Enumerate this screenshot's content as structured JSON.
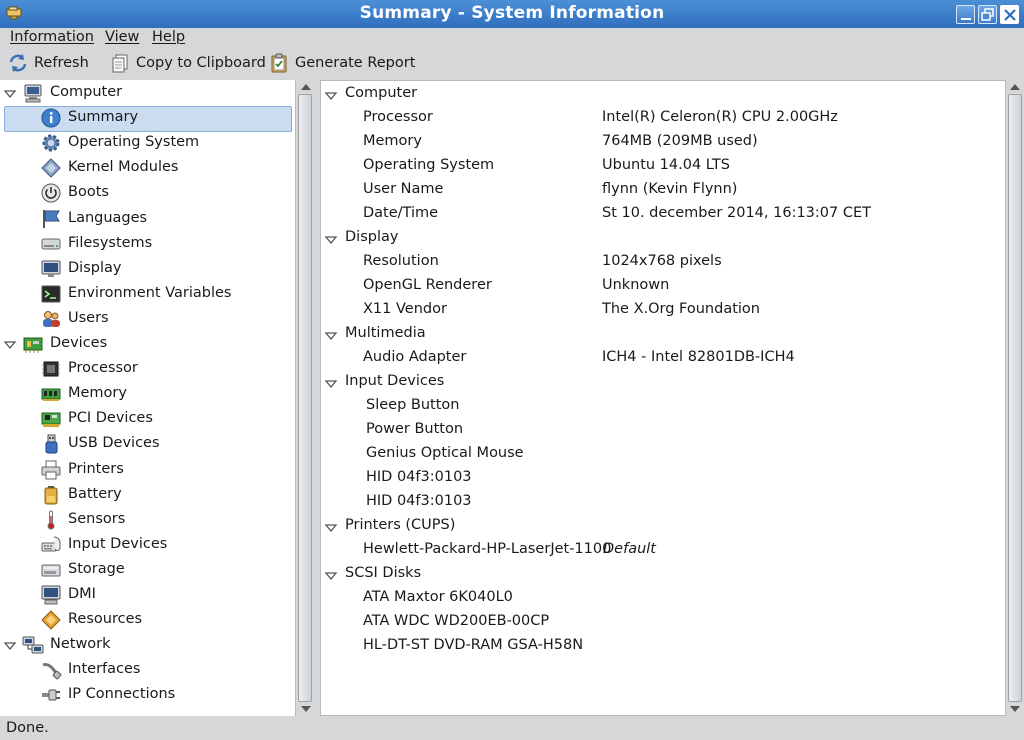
{
  "window": {
    "title": "Summary - System Information"
  },
  "menu": [
    "Information",
    "View",
    "Help"
  ],
  "toolbar": {
    "refresh": "Refresh",
    "copy": "Copy to Clipboard",
    "report": "Generate Report"
  },
  "tree": [
    {
      "label": "Computer",
      "level": 0,
      "icon": "computer-icon"
    },
    {
      "label": "Summary",
      "level": 1,
      "icon": "info-icon",
      "selected": true
    },
    {
      "label": "Operating System",
      "level": 1,
      "icon": "gear-icon"
    },
    {
      "label": "Kernel Modules",
      "level": 1,
      "icon": "module-icon"
    },
    {
      "label": "Boots",
      "level": 1,
      "icon": "power-icon"
    },
    {
      "label": "Languages",
      "level": 1,
      "icon": "flag-icon"
    },
    {
      "label": "Filesystems",
      "level": 1,
      "icon": "drive-icon"
    },
    {
      "label": "Display",
      "level": 1,
      "icon": "monitor-icon"
    },
    {
      "label": "Environment Variables",
      "level": 1,
      "icon": "terminal-icon"
    },
    {
      "label": "Users",
      "level": 1,
      "icon": "users-icon"
    },
    {
      "label": "Devices",
      "level": 0,
      "icon": "devices-icon"
    },
    {
      "label": "Processor",
      "level": 1,
      "icon": "cpu-icon"
    },
    {
      "label": "Memory",
      "level": 1,
      "icon": "memory-icon"
    },
    {
      "label": "PCI Devices",
      "level": 1,
      "icon": "pci-icon"
    },
    {
      "label": "USB Devices",
      "level": 1,
      "icon": "usb-icon"
    },
    {
      "label": "Printers",
      "level": 1,
      "icon": "printer-icon"
    },
    {
      "label": "Battery",
      "level": 1,
      "icon": "battery-icon"
    },
    {
      "label": "Sensors",
      "level": 1,
      "icon": "thermometer-icon"
    },
    {
      "label": "Input Devices",
      "level": 1,
      "icon": "keyboard-icon"
    },
    {
      "label": "Storage",
      "level": 1,
      "icon": "storage-icon"
    },
    {
      "label": "DMI",
      "level": 1,
      "icon": "dmi-icon"
    },
    {
      "label": "Resources",
      "level": 1,
      "icon": "resources-icon"
    },
    {
      "label": "Network",
      "level": 0,
      "icon": "network-icon"
    },
    {
      "label": "Interfaces",
      "level": 1,
      "icon": "cable-icon"
    },
    {
      "label": "IP Connections",
      "level": 1,
      "icon": "plug-icon"
    }
  ],
  "details": [
    {
      "type": "section",
      "label": "Computer"
    },
    {
      "type": "kv",
      "key": "Processor",
      "value": "Intel(R) Celeron(R) CPU 2.00GHz"
    },
    {
      "type": "kv",
      "key": "Memory",
      "value": "764MB (209MB used)"
    },
    {
      "type": "kv",
      "key": "Operating System",
      "value": "Ubuntu 14.04 LTS"
    },
    {
      "type": "kv",
      "key": "User Name",
      "value": "flynn (Kevin Flynn)"
    },
    {
      "type": "kv",
      "key": "Date/Time",
      "value": "St 10. december 2014, 16:13:07 CET"
    },
    {
      "type": "section",
      "label": "Display"
    },
    {
      "type": "kv",
      "key": "Resolution",
      "value": "1024x768 pixels"
    },
    {
      "type": "kv",
      "key": "OpenGL Renderer",
      "value": "Unknown"
    },
    {
      "type": "kv",
      "key": "X11 Vendor",
      "value": "The X.Org Foundation"
    },
    {
      "type": "section",
      "label": "Multimedia"
    },
    {
      "type": "kv",
      "key": "Audio Adapter",
      "value": "ICH4 - Intel 82801DB-ICH4"
    },
    {
      "type": "section",
      "label": "Input Devices"
    },
    {
      "type": "item",
      "key": "Sleep Button"
    },
    {
      "type": "item",
      "key": "Power Button"
    },
    {
      "type": "item",
      "key": "Genius Optical Mouse"
    },
    {
      "type": "item",
      "key": "HID 04f3:0103"
    },
    {
      "type": "item",
      "key": "HID 04f3:0103"
    },
    {
      "type": "section",
      "label": "Printers (CUPS)"
    },
    {
      "type": "kv",
      "key": "Hewlett-Packard-HP-LaserJet-1100",
      "value": "Default",
      "italic": true
    },
    {
      "type": "section",
      "label": "SCSI Disks"
    },
    {
      "type": "kv",
      "key": "ATA Maxtor 6K040L0",
      "value": ""
    },
    {
      "type": "kv",
      "key": "ATA WDC WD200EB-00CP",
      "value": ""
    },
    {
      "type": "kv",
      "key": "HL-DT-ST DVD-RAM GSA-H58N",
      "value": ""
    }
  ],
  "status": "Done.",
  "colors": {
    "titlebar": "#2f6fbf",
    "selection": "#cbdcf0",
    "chrome": "#d6d7d9"
  }
}
